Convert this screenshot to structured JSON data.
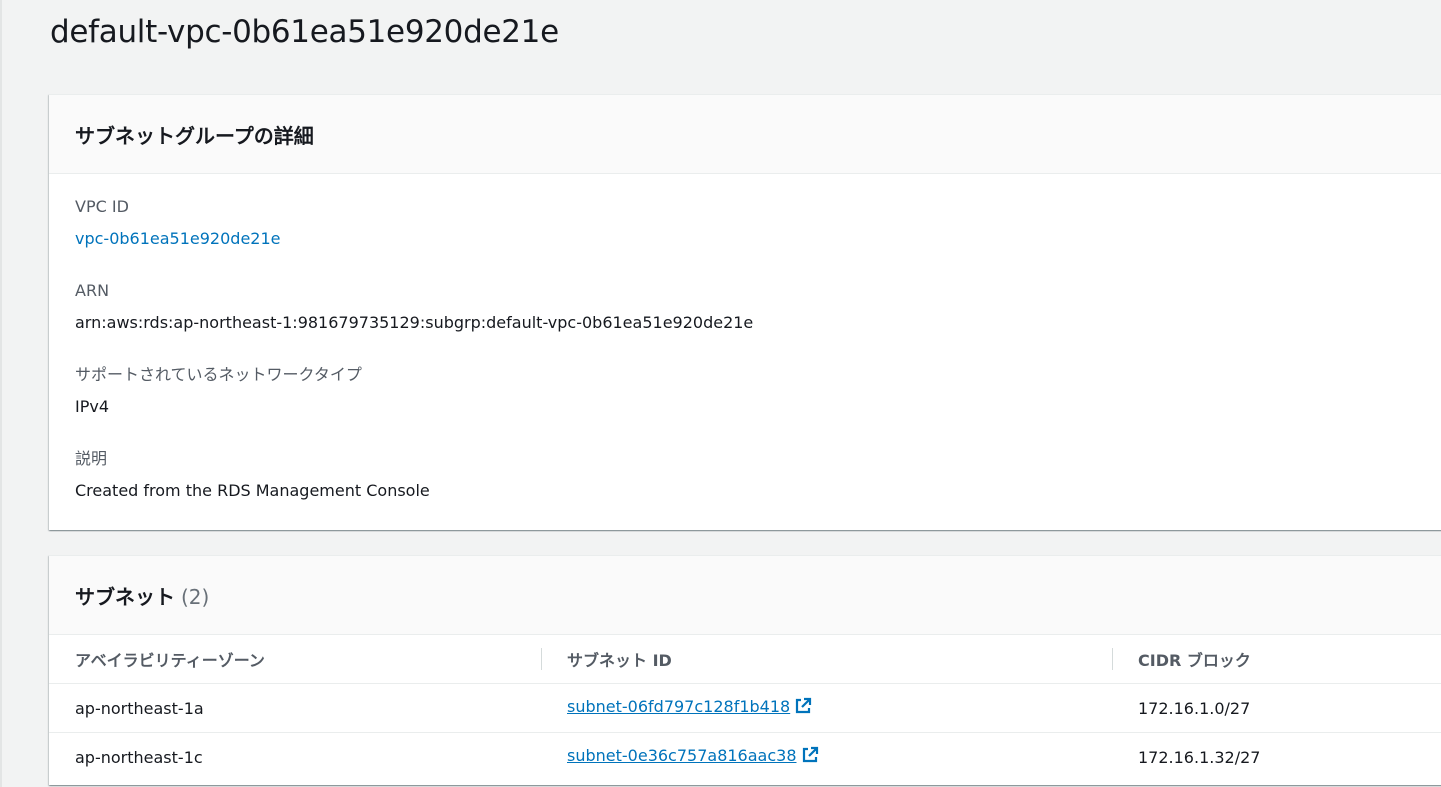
{
  "page": {
    "title": "default-vpc-0b61ea51e920de21e"
  },
  "details_panel": {
    "header": "サブネットグループの詳細",
    "fields": [
      {
        "key": "VPC ID",
        "value": "vpc-0b61ea51e920de21e"
      },
      {
        "key": "ARN",
        "value": "arn:aws:rds:ap-northeast-1:981679735129:subgrp:default-vpc-0b61ea51e920de21e"
      },
      {
        "key": "サポートされているネットワークタイプ",
        "value": "IPv4"
      },
      {
        "key": "説明",
        "value": "Created from the RDS Management Console"
      }
    ]
  },
  "subnets_panel": {
    "header": "サブネット",
    "count": "(2)",
    "columns": [
      "アベイラビリティーゾーン",
      "サブネット ID",
      "CIDR ブロック"
    ],
    "rows": [
      {
        "az": "ap-northeast-1a",
        "subnet_id": "subnet-06fd797c128f1b418",
        "cidr": "172.16.1.0/27"
      },
      {
        "az": "ap-northeast-1c",
        "subnet_id": "subnet-0e36c757a816aac38",
        "cidr": "172.16.1.32/27"
      }
    ]
  },
  "icons": {
    "external_link": "external-link-icon"
  },
  "colors": {
    "link": "#0073bb",
    "page_bg": "#f2f3f3",
    "text": "#16191f",
    "label": "#545b64"
  }
}
